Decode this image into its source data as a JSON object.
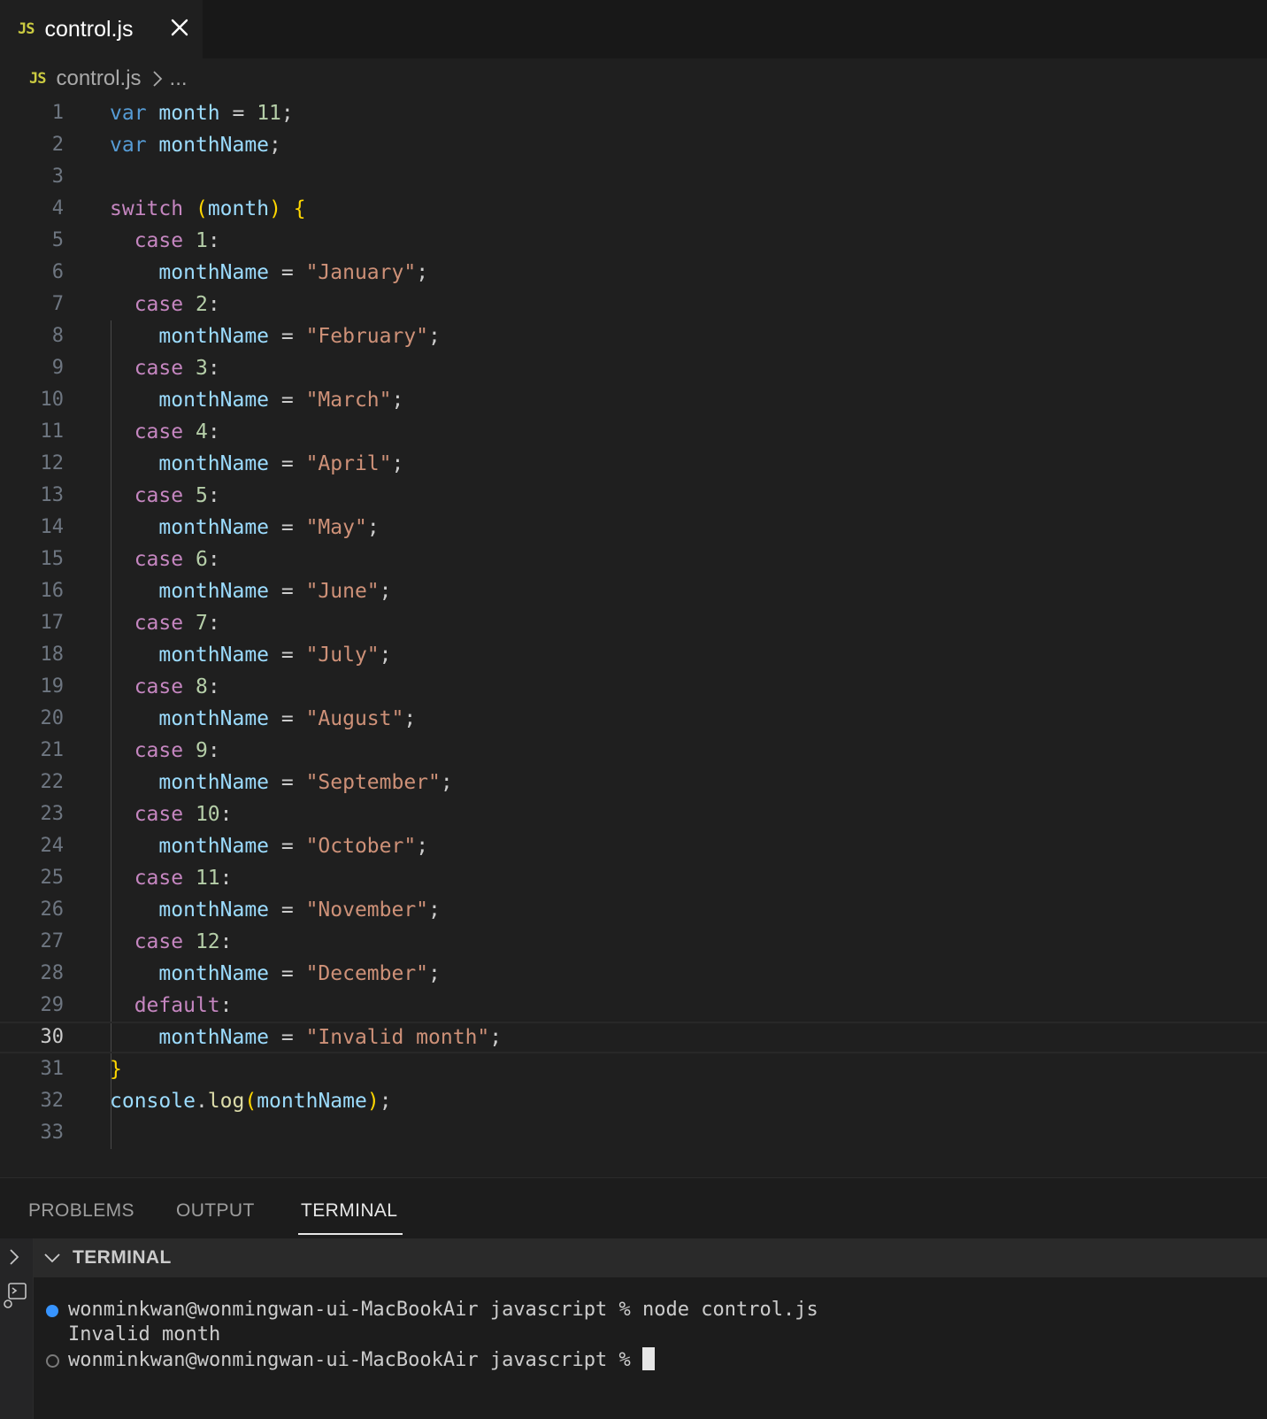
{
  "tab": {
    "icon": "JS",
    "label": "control.js"
  },
  "breadcrumb": {
    "icon": "JS",
    "file": "control.js",
    "more": "..."
  },
  "editor": {
    "active_line": 30,
    "lines": [
      {
        "n": "1",
        "t": [
          [
            "kw",
            "var"
          ],
          [
            "pu",
            " "
          ],
          [
            "var",
            "month"
          ],
          [
            "pu",
            " = "
          ],
          [
            "num",
            "11"
          ],
          [
            "pu",
            ";"
          ]
        ]
      },
      {
        "n": "2",
        "t": [
          [
            "kw",
            "var"
          ],
          [
            "pu",
            " "
          ],
          [
            "var",
            "monthName"
          ],
          [
            "pu",
            ";"
          ]
        ]
      },
      {
        "n": "3",
        "t": []
      },
      {
        "n": "4",
        "t": [
          [
            "ctl",
            "switch"
          ],
          [
            "pu",
            " "
          ],
          [
            "p1",
            "("
          ],
          [
            "var",
            "month"
          ],
          [
            "p1",
            ")"
          ],
          [
            "pu",
            " "
          ],
          [
            "p1",
            "{"
          ]
        ]
      },
      {
        "n": "5",
        "t": [
          [
            "pu",
            "  "
          ],
          [
            "ctl",
            "case"
          ],
          [
            "pu",
            " "
          ],
          [
            "num",
            "1"
          ],
          [
            "pu",
            ":"
          ]
        ]
      },
      {
        "n": "6",
        "t": [
          [
            "pu",
            "    "
          ],
          [
            "var",
            "monthName"
          ],
          [
            "pu",
            " = "
          ],
          [
            "str",
            "\"January\""
          ],
          [
            "pu",
            ";"
          ]
        ]
      },
      {
        "n": "7",
        "t": [
          [
            "pu",
            "  "
          ],
          [
            "ctl",
            "case"
          ],
          [
            "pu",
            " "
          ],
          [
            "num",
            "2"
          ],
          [
            "pu",
            ":"
          ]
        ]
      },
      {
        "n": "8",
        "t": [
          [
            "pu",
            "    "
          ],
          [
            "var",
            "monthName"
          ],
          [
            "pu",
            " = "
          ],
          [
            "str",
            "\"February\""
          ],
          [
            "pu",
            ";"
          ]
        ]
      },
      {
        "n": "9",
        "t": [
          [
            "pu",
            "  "
          ],
          [
            "ctl",
            "case"
          ],
          [
            "pu",
            " "
          ],
          [
            "num",
            "3"
          ],
          [
            "pu",
            ":"
          ]
        ]
      },
      {
        "n": "10",
        "t": [
          [
            "pu",
            "    "
          ],
          [
            "var",
            "monthName"
          ],
          [
            "pu",
            " = "
          ],
          [
            "str",
            "\"March\""
          ],
          [
            "pu",
            ";"
          ]
        ]
      },
      {
        "n": "11",
        "t": [
          [
            "pu",
            "  "
          ],
          [
            "ctl",
            "case"
          ],
          [
            "pu",
            " "
          ],
          [
            "num",
            "4"
          ],
          [
            "pu",
            ":"
          ]
        ]
      },
      {
        "n": "12",
        "t": [
          [
            "pu",
            "    "
          ],
          [
            "var",
            "monthName"
          ],
          [
            "pu",
            " = "
          ],
          [
            "str",
            "\"April\""
          ],
          [
            "pu",
            ";"
          ]
        ]
      },
      {
        "n": "13",
        "t": [
          [
            "pu",
            "  "
          ],
          [
            "ctl",
            "case"
          ],
          [
            "pu",
            " "
          ],
          [
            "num",
            "5"
          ],
          [
            "pu",
            ":"
          ]
        ]
      },
      {
        "n": "14",
        "t": [
          [
            "pu",
            "    "
          ],
          [
            "var",
            "monthName"
          ],
          [
            "pu",
            " = "
          ],
          [
            "str",
            "\"May\""
          ],
          [
            "pu",
            ";"
          ]
        ]
      },
      {
        "n": "15",
        "t": [
          [
            "pu",
            "  "
          ],
          [
            "ctl",
            "case"
          ],
          [
            "pu",
            " "
          ],
          [
            "num",
            "6"
          ],
          [
            "pu",
            ":"
          ]
        ]
      },
      {
        "n": "16",
        "t": [
          [
            "pu",
            "    "
          ],
          [
            "var",
            "monthName"
          ],
          [
            "pu",
            " = "
          ],
          [
            "str",
            "\"June\""
          ],
          [
            "pu",
            ";"
          ]
        ]
      },
      {
        "n": "17",
        "t": [
          [
            "pu",
            "  "
          ],
          [
            "ctl",
            "case"
          ],
          [
            "pu",
            " "
          ],
          [
            "num",
            "7"
          ],
          [
            "pu",
            ":"
          ]
        ]
      },
      {
        "n": "18",
        "t": [
          [
            "pu",
            "    "
          ],
          [
            "var",
            "monthName"
          ],
          [
            "pu",
            " = "
          ],
          [
            "str",
            "\"July\""
          ],
          [
            "pu",
            ";"
          ]
        ]
      },
      {
        "n": "19",
        "t": [
          [
            "pu",
            "  "
          ],
          [
            "ctl",
            "case"
          ],
          [
            "pu",
            " "
          ],
          [
            "num",
            "8"
          ],
          [
            "pu",
            ":"
          ]
        ]
      },
      {
        "n": "20",
        "t": [
          [
            "pu",
            "    "
          ],
          [
            "var",
            "monthName"
          ],
          [
            "pu",
            " = "
          ],
          [
            "str",
            "\"August\""
          ],
          [
            "pu",
            ";"
          ]
        ]
      },
      {
        "n": "21",
        "t": [
          [
            "pu",
            "  "
          ],
          [
            "ctl",
            "case"
          ],
          [
            "pu",
            " "
          ],
          [
            "num",
            "9"
          ],
          [
            "pu",
            ":"
          ]
        ]
      },
      {
        "n": "22",
        "t": [
          [
            "pu",
            "    "
          ],
          [
            "var",
            "monthName"
          ],
          [
            "pu",
            " = "
          ],
          [
            "str",
            "\"September\""
          ],
          [
            "pu",
            ";"
          ]
        ]
      },
      {
        "n": "23",
        "t": [
          [
            "pu",
            "  "
          ],
          [
            "ctl",
            "case"
          ],
          [
            "pu",
            " "
          ],
          [
            "num",
            "10"
          ],
          [
            "pu",
            ":"
          ]
        ]
      },
      {
        "n": "24",
        "t": [
          [
            "pu",
            "    "
          ],
          [
            "var",
            "monthName"
          ],
          [
            "pu",
            " = "
          ],
          [
            "str",
            "\"October\""
          ],
          [
            "pu",
            ";"
          ]
        ]
      },
      {
        "n": "25",
        "t": [
          [
            "pu",
            "  "
          ],
          [
            "ctl",
            "case"
          ],
          [
            "pu",
            " "
          ],
          [
            "num",
            "11"
          ],
          [
            "pu",
            ":"
          ]
        ]
      },
      {
        "n": "26",
        "t": [
          [
            "pu",
            "    "
          ],
          [
            "var",
            "monthName"
          ],
          [
            "pu",
            " = "
          ],
          [
            "str",
            "\"November\""
          ],
          [
            "pu",
            ";"
          ]
        ]
      },
      {
        "n": "27",
        "t": [
          [
            "pu",
            "  "
          ],
          [
            "ctl",
            "case"
          ],
          [
            "pu",
            " "
          ],
          [
            "num",
            "12"
          ],
          [
            "pu",
            ":"
          ]
        ]
      },
      {
        "n": "28",
        "t": [
          [
            "pu",
            "    "
          ],
          [
            "var",
            "monthName"
          ],
          [
            "pu",
            " = "
          ],
          [
            "str",
            "\"December\""
          ],
          [
            "pu",
            ";"
          ]
        ]
      },
      {
        "n": "29",
        "t": [
          [
            "pu",
            "  "
          ],
          [
            "ctl",
            "default"
          ],
          [
            "pu",
            ":"
          ]
        ]
      },
      {
        "n": "30",
        "t": [
          [
            "pu",
            "    "
          ],
          [
            "var",
            "monthName"
          ],
          [
            "pu",
            " = "
          ],
          [
            "str",
            "\"Invalid month\""
          ],
          [
            "pu",
            ";"
          ]
        ]
      },
      {
        "n": "31",
        "t": [
          [
            "p1",
            "}"
          ]
        ]
      },
      {
        "n": "32",
        "t": [
          [
            "var",
            "console"
          ],
          [
            "pu",
            "."
          ],
          [
            "fn",
            "log"
          ],
          [
            "p1",
            "("
          ],
          [
            "var",
            "monthName"
          ],
          [
            "p1",
            ")"
          ],
          [
            "pu",
            ";"
          ]
        ]
      },
      {
        "n": "33",
        "t": []
      }
    ]
  },
  "panel": {
    "tabs": [
      "PROBLEMS",
      "OUTPUT",
      "TERMINAL"
    ],
    "active_tab": "TERMINAL",
    "terminal_header": "TERMINAL",
    "terminal_lines": [
      "wonminkwan@wonmingwan-ui-MacBookAir javascript % node control.js",
      "Invalid month",
      "wonminkwan@wonmingwan-ui-MacBookAir javascript % "
    ]
  },
  "colors": {
    "accent": "#3794ff",
    "keyword": "#569cd6",
    "control": "#c586c0",
    "string": "#ce9178"
  },
  "icons": [
    "close-icon",
    "chevron-right-icon",
    "chevron-down-icon",
    "terminal-icon"
  ]
}
